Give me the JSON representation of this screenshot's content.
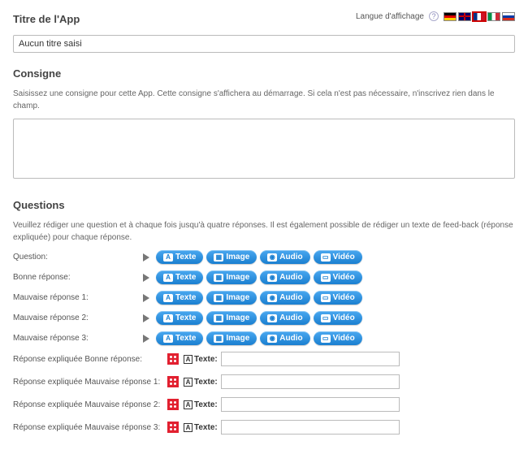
{
  "header": {
    "title_label": "Titre de l'App",
    "lang_label": "Langue d'affichage",
    "title_value": "Aucun titre saisi",
    "flags": [
      "de",
      "en",
      "fr",
      "it",
      "ru"
    ],
    "selected_flag": "fr"
  },
  "consigne": {
    "heading": "Consigne",
    "desc": "Saisissez une consigne pour cette App. Cette consigne s'affichera au démarrage. Si cela n'est pas nécessaire, n'inscrivez rien dans le champ.",
    "value": ""
  },
  "questions": {
    "heading": "Questions",
    "desc": "Veuillez rédiger une question et à chaque fois jusqu'à quatre réponses. Il est également possible de rédiger un texte de feed-back (réponse expliquée) pour chaque réponse.",
    "rows": [
      {
        "label": "Question:"
      },
      {
        "label": "Bonne réponse:"
      },
      {
        "label": "Mauvaise réponse 1:"
      },
      {
        "label": "Mauvaise réponse 2:"
      },
      {
        "label": "Mauvaise réponse 3:"
      }
    ],
    "media_buttons": [
      {
        "icon": "A",
        "label": "Texte"
      },
      {
        "icon": "▦",
        "label": "Image"
      },
      {
        "icon": "◉",
        "label": "Audio"
      },
      {
        "icon": "▭",
        "label": "Vidéo"
      }
    ],
    "explained": [
      {
        "label": "Réponse expliquée Bonne réponse:",
        "value": ""
      },
      {
        "label": "Réponse expliquée Mauvaise réponse 1:",
        "value": ""
      },
      {
        "label": "Réponse expliquée Mauvaise réponse 2:",
        "value": ""
      },
      {
        "label": "Réponse expliquée Mauvaise réponse 3:",
        "value": ""
      }
    ],
    "text_prefix": "Texte:"
  }
}
